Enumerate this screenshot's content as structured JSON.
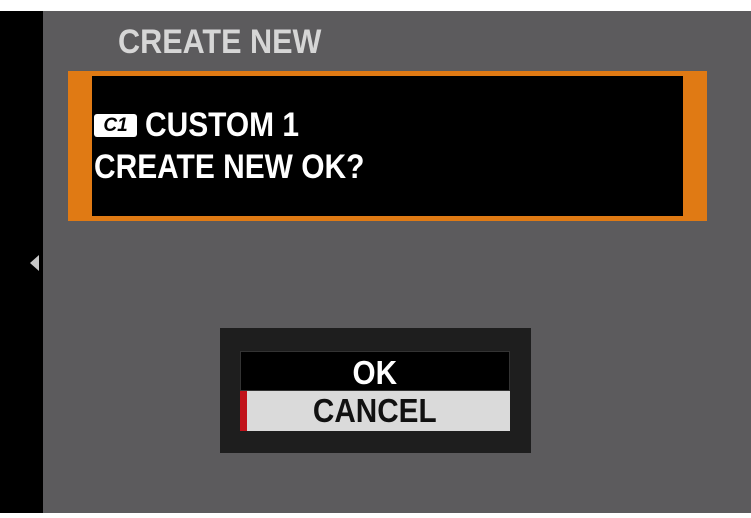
{
  "screen": {
    "title": "CREATE NEW",
    "colors": {
      "background": "#5c5b5d",
      "accent": "#e07a14",
      "selection_marker": "#c1121a"
    }
  },
  "message": {
    "badge_icon": "C1",
    "line1": "CUSTOM 1",
    "line2": "CREATE NEW OK?"
  },
  "dialog": {
    "options": [
      {
        "label": "OK",
        "selected": false
      },
      {
        "label": "CANCEL",
        "selected": true
      }
    ]
  },
  "icons": {
    "left_arrow": "left-arrow-icon",
    "c1_badge": "c1-badge-icon"
  }
}
